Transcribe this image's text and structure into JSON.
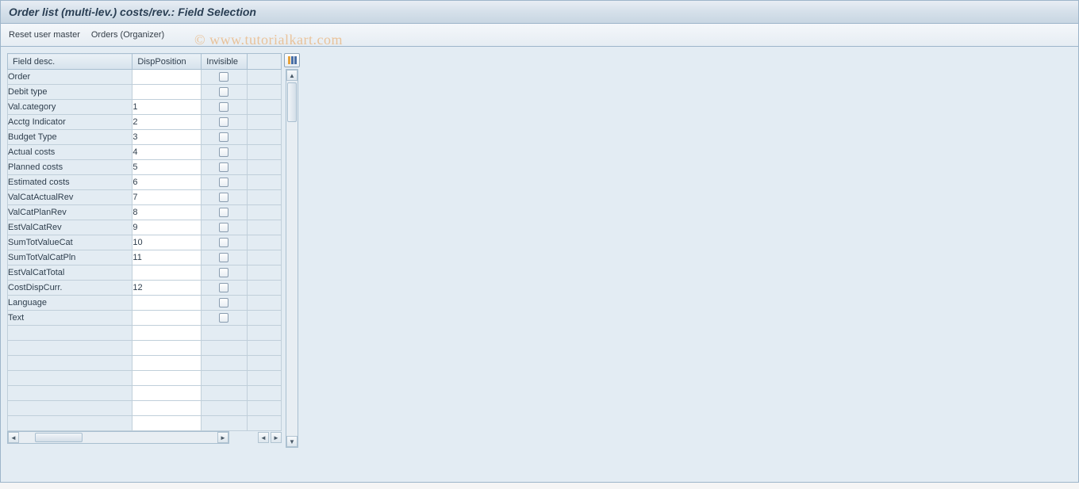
{
  "title": "Order list (multi-lev.) costs/rev.: Field Selection",
  "toolbar": {
    "reset_label": "Reset user master",
    "orders_label": "Orders (Organizer)"
  },
  "columns": {
    "field_desc": "Field desc.",
    "disp_position": "DispPosition",
    "invisible": "Invisible"
  },
  "rows": [
    {
      "desc": "Order",
      "pos": ""
    },
    {
      "desc": "Debit type",
      "pos": ""
    },
    {
      "desc": "Val.category",
      "pos": "1"
    },
    {
      "desc": "Acctg Indicator",
      "pos": "2"
    },
    {
      "desc": "Budget Type",
      "pos": "3"
    },
    {
      "desc": "Actual costs",
      "pos": "4"
    },
    {
      "desc": "Planned costs",
      "pos": "5"
    },
    {
      "desc": "Estimated costs",
      "pos": "6"
    },
    {
      "desc": "ValCatActualRev",
      "pos": "7"
    },
    {
      "desc": "ValCatPlanRev",
      "pos": "8"
    },
    {
      "desc": "EstValCatRev",
      "pos": "9"
    },
    {
      "desc": "SumTotValueCat",
      "pos": "10"
    },
    {
      "desc": "SumTotValCatPln",
      "pos": "11"
    },
    {
      "desc": "EstValCatTotal",
      "pos": ""
    },
    {
      "desc": "CostDispCurr.",
      "pos": "12"
    },
    {
      "desc": "Language",
      "pos": ""
    },
    {
      "desc": "Text",
      "pos": ""
    }
  ],
  "watermark": "© www.tutorialkart.com"
}
